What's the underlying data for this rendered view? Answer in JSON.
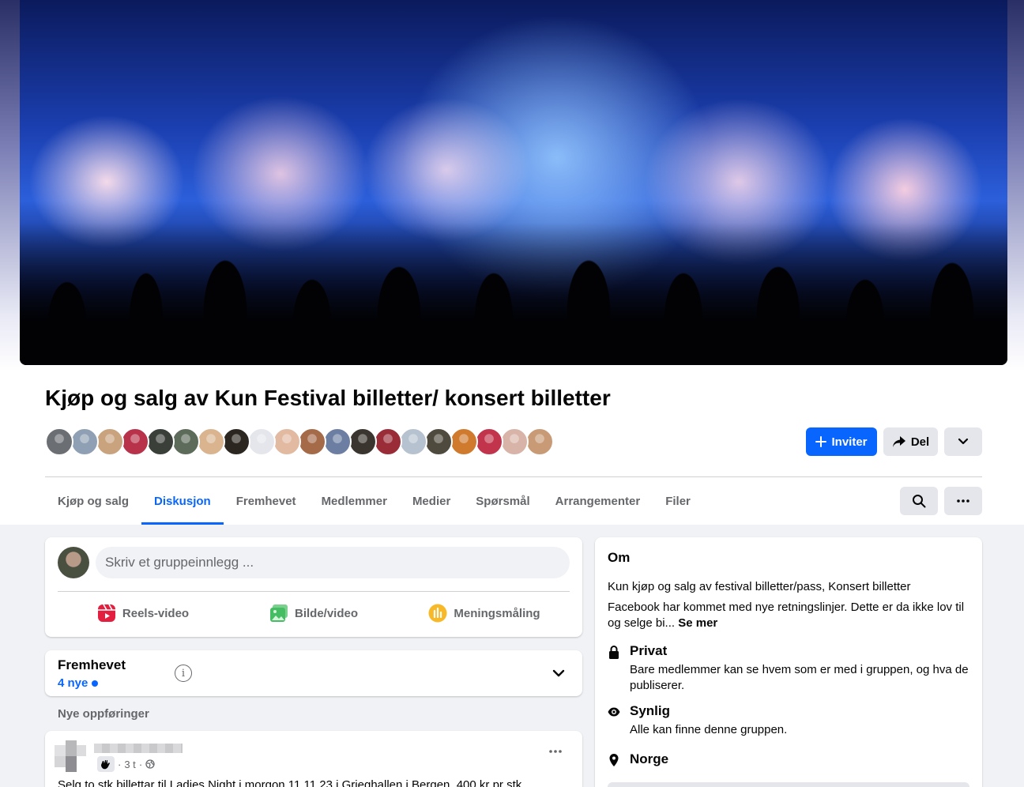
{
  "group": {
    "title": "Kjøp og salg av Kun Festival billetter/ konsert billetter"
  },
  "member_avatars": [
    {
      "color": "#6b6f74"
    },
    {
      "color": "#8fa0b4"
    },
    {
      "color": "#c9a27e"
    },
    {
      "color": "#b8324a"
    },
    {
      "color": "#3a3f3a"
    },
    {
      "color": "#5d6b5a"
    },
    {
      "color": "#d9b48f"
    },
    {
      "color": "#2c2620"
    },
    {
      "color": "#e4e6eb"
    },
    {
      "color": "#e2b9a1"
    },
    {
      "color": "#a56a48"
    },
    {
      "color": "#6c7fa3"
    },
    {
      "color": "#3b3530"
    },
    {
      "color": "#9a2c38"
    },
    {
      "color": "#b6c2cf"
    },
    {
      "color": "#4f4a3e"
    },
    {
      "color": "#d07a2e"
    },
    {
      "color": "#c2344c"
    },
    {
      "color": "#d8b3a8"
    },
    {
      "color": "#c89a76"
    }
  ],
  "actions": {
    "invite_label": "Inviter",
    "share_label": "Del"
  },
  "tabs": [
    {
      "label": "Kjøp og salg",
      "active": false
    },
    {
      "label": "Diskusjon",
      "active": true
    },
    {
      "label": "Fremhevet",
      "active": false
    },
    {
      "label": "Medlemmer",
      "active": false
    },
    {
      "label": "Medier",
      "active": false
    },
    {
      "label": "Spørsmål",
      "active": false
    },
    {
      "label": "Arrangementer",
      "active": false
    },
    {
      "label": "Filer",
      "active": false
    }
  ],
  "composer": {
    "placeholder": "Skriv et gruppeinnlegg ...",
    "actions": [
      {
        "label": "Reels-video",
        "icon": "reels-icon",
        "color": "#e41e3f"
      },
      {
        "label": "Bilde/video",
        "icon": "photo-icon",
        "color": "#45bd62"
      },
      {
        "label": "Meningsmåling",
        "icon": "poll-icon",
        "color": "#f7b928"
      }
    ]
  },
  "featured": {
    "title": "Fremhevet",
    "new_count": "4 nye"
  },
  "feed": {
    "section_label": "Nye oppføringer",
    "post": {
      "time": "3 t",
      "text": "Selg to stk billettar til Ladies Night i morgon 11.11.23 i Grieghallen i Bergen. 400 kr pr stk"
    }
  },
  "about": {
    "heading": "Om",
    "description_1": "Kun kjøp og salg av festival billetter/pass, Konsert billetter",
    "description_2": "Facebook har kommet med nye retningslinjer. Dette er da ikke lov til og selge bi...",
    "see_more": "Se mer",
    "privacy_title": "Privat",
    "privacy_desc": "Bare medlemmer kan se hvem som er med i gruppen, og hva de publiserer.",
    "visibility_title": "Synlig",
    "visibility_desc": "Alle kan finne denne gruppen.",
    "location": "Norge"
  },
  "colors": {
    "accent": "#0866ff",
    "page_bg": "#f0f2f5",
    "secondary_text": "#65676b"
  }
}
